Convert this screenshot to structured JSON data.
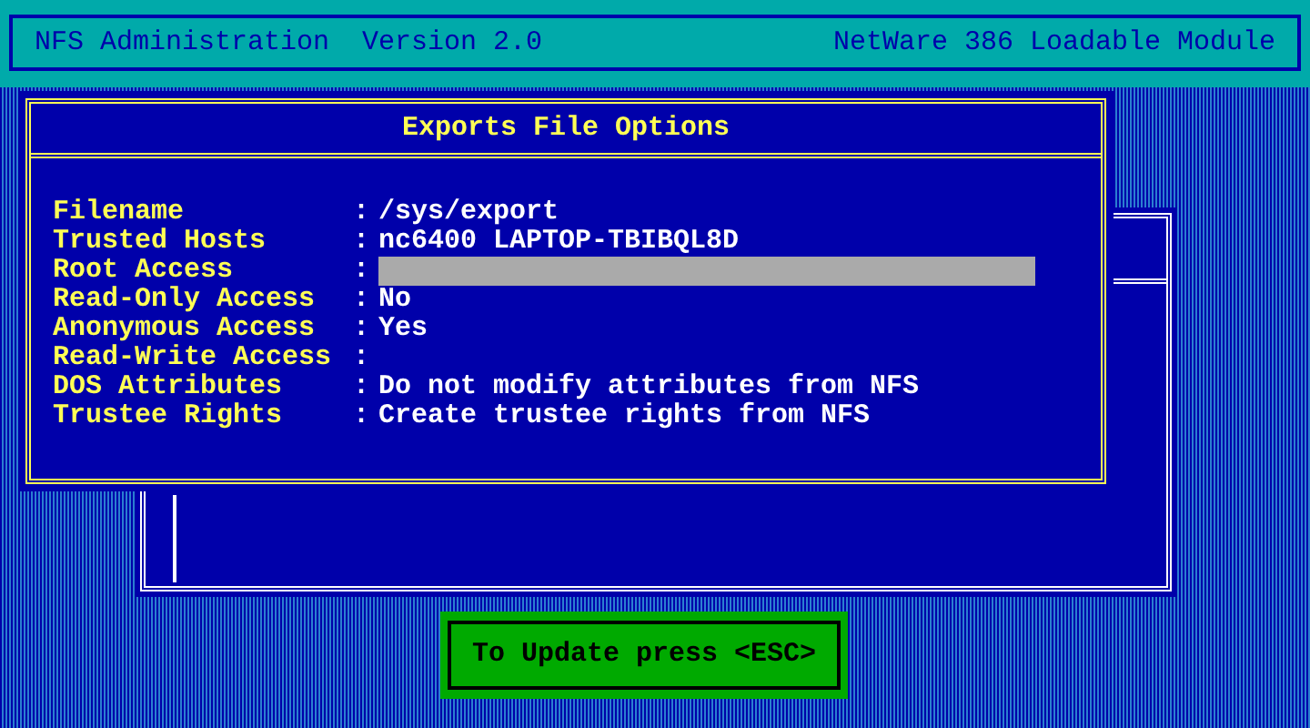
{
  "header": {
    "title": "NFS Administration  Version 2.0",
    "module": "NetWare 386 Loadable Module"
  },
  "dialog": {
    "title": "Exports File Options",
    "fields": [
      {
        "label": "Filename",
        "separator": ":",
        "value": "/sys/export",
        "selected": false
      },
      {
        "label": "Trusted Hosts",
        "separator": ":",
        "value": "nc6400 LAPTOP-TBIBQL8D",
        "selected": false
      },
      {
        "label": "Root Access",
        "separator": ":",
        "selected": true
      },
      {
        "label": "Read-Only Access",
        "separator": ":",
        "value": "No",
        "selected": false
      },
      {
        "label": "Anonymous Access",
        "separator": ":",
        "value": "Yes",
        "selected": false
      },
      {
        "label": "Read-Write Access",
        "separator": ":",
        "selected": false
      },
      {
        "label": "DOS Attributes",
        "separator": ":",
        "value": "Do not modify attributes from NFS",
        "selected": false
      },
      {
        "label": "Trustee Rights",
        "separator": ":",
        "value": "Create trustee rights from NFS",
        "selected": false
      }
    ]
  },
  "status": {
    "message": "To Update press <ESC>"
  }
}
